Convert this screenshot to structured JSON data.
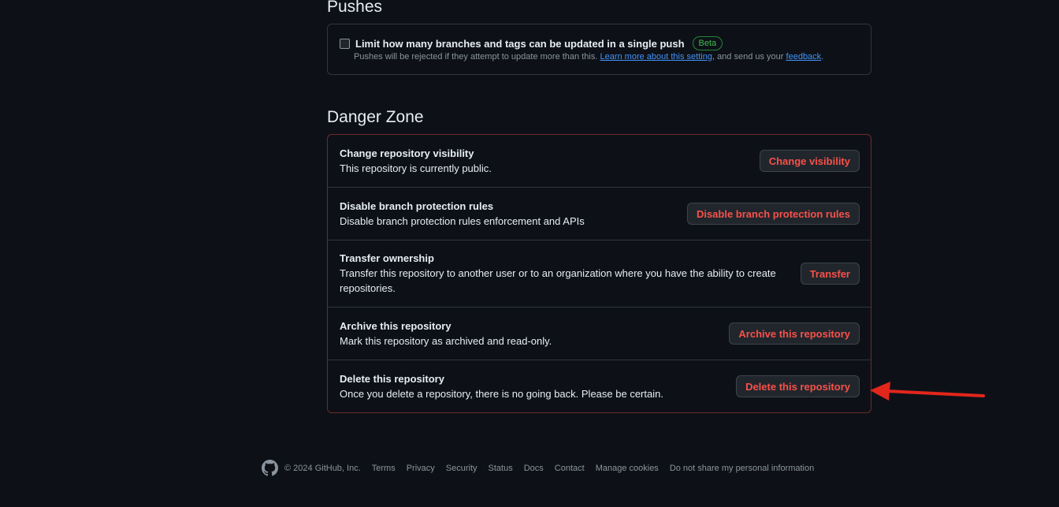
{
  "pushes": {
    "title": "Pushes",
    "checkbox_label": "Limit how many branches and tags can be updated in a single push",
    "badge": "Beta",
    "note_prefix": "Pushes will be rejected if they attempt to update more than this.",
    "note_link1": "Learn more about this setting",
    "note_middle": ", and send us your",
    "note_link2": "feedback",
    "note_suffix": "."
  },
  "danger_zone": {
    "title": "Danger Zone",
    "rows": [
      {
        "title": "Change repository visibility",
        "description": "This repository is currently public.",
        "button": "Change visibility"
      },
      {
        "title": "Disable branch protection rules",
        "description": "Disable branch protection rules enforcement and APIs",
        "button": "Disable branch protection rules"
      },
      {
        "title": "Transfer ownership",
        "description": "Transfer this repository to another user or to an organization where you have the ability to create repositories.",
        "button": "Transfer"
      },
      {
        "title": "Archive this repository",
        "description": "Mark this repository as archived and read-only.",
        "button": "Archive this repository"
      },
      {
        "title": "Delete this repository",
        "description": "Once you delete a repository, there is no going back. Please be certain.",
        "button": "Delete this repository"
      }
    ]
  },
  "annotation": {
    "arrow_color": "#e3261c",
    "icon": "arrow-left-icon"
  },
  "footer": {
    "icon": "github-logo-icon",
    "copyright": "© 2024 GitHub, Inc.",
    "links": [
      "Terms",
      "Privacy",
      "Security",
      "Status",
      "Docs",
      "Contact",
      "Manage cookies",
      "Do not share my personal information"
    ]
  },
  "colors": {
    "background": "#0d1117",
    "danger": "#f85149",
    "danger_border": "#6e2a2e",
    "link": "#4493f8",
    "beta": "#3fb950"
  }
}
